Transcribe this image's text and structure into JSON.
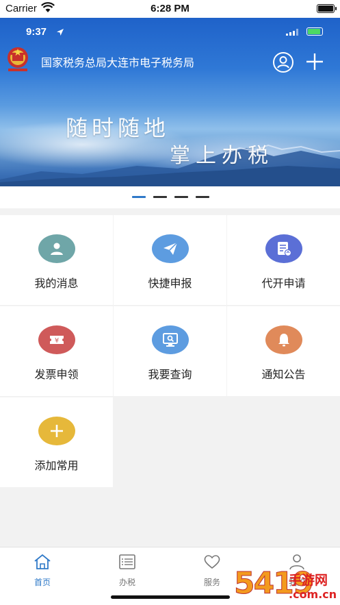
{
  "sim_status": {
    "carrier": "Carrier",
    "time": "6:28 PM"
  },
  "inner_status": {
    "time": "9:37"
  },
  "header": {
    "title": "国家税务总局大连市电子税务局",
    "slogan_line1": "随时随地",
    "slogan_line2": "掌上办税"
  },
  "pager": {
    "count": 4,
    "active_index": 0
  },
  "grid": {
    "items": [
      {
        "label": "我的消息",
        "icon": "user-message-icon",
        "color": "#6fa6a8"
      },
      {
        "label": "快捷申报",
        "icon": "paper-plane-icon",
        "color": "#5d9ce0"
      },
      {
        "label": "代开申请",
        "icon": "document-edit-icon",
        "color": "#5b6fd6"
      },
      {
        "label": "发票申领",
        "icon": "invoice-ticket-icon",
        "color": "#cf5a5a"
      },
      {
        "label": "我要查询",
        "icon": "monitor-search-icon",
        "color": "#5d9ce0"
      },
      {
        "label": "通知公告",
        "icon": "bell-icon",
        "color": "#e08a5a"
      },
      {
        "label": "添加常用",
        "icon": "plus-icon",
        "color": "#e6b83a"
      }
    ]
  },
  "tabbar": {
    "items": [
      {
        "label": "首页",
        "icon": "home-icon",
        "active": true
      },
      {
        "label": "办税",
        "icon": "list-icon",
        "active": false
      },
      {
        "label": "服务",
        "icon": "heart-icon",
        "active": false
      },
      {
        "label": "我的",
        "icon": "person-icon",
        "active": false
      }
    ]
  },
  "watermark": {
    "big": "5419",
    "cn": "手游网",
    "domain": ".com.cn"
  },
  "colors": {
    "accent": "#2f79c8",
    "banner": "#2f78d6"
  }
}
